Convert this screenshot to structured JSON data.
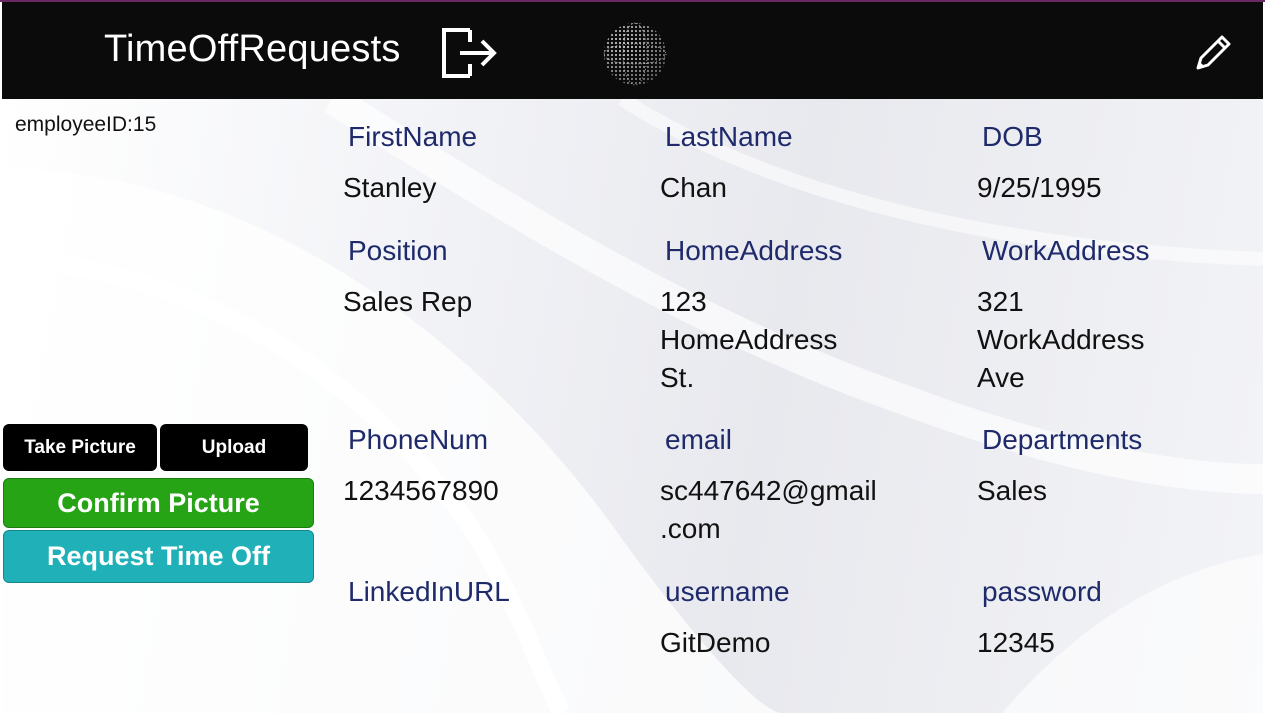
{
  "header": {
    "title": "TimeOffRequests",
    "icons": [
      "logout-icon",
      "globe-icon",
      "edit-icon"
    ]
  },
  "employee": {
    "id_label": "employeeID:15"
  },
  "fields": {
    "first_name": {
      "label": "FirstName",
      "value": "Stanley"
    },
    "last_name": {
      "label": "LastName",
      "value": "Chan"
    },
    "dob": {
      "label": "DOB",
      "value": "9/25/1995"
    },
    "position": {
      "label": "Position",
      "value": "Sales Rep"
    },
    "home_address": {
      "label": "HomeAddress",
      "value": "123\nHomeAddress\nSt."
    },
    "work_address": {
      "label": "WorkAddress",
      "value": "321\nWorkAddress\nAve"
    },
    "phone": {
      "label": "PhoneNum",
      "value": "1234567890"
    },
    "email": {
      "label": "email",
      "value": "sc447642@gmail\n.com"
    },
    "departments": {
      "label": "Departments",
      "value": "Sales"
    },
    "linkedin": {
      "label": "LinkedInURL",
      "value": ""
    },
    "username": {
      "label": "username",
      "value": "GitDemo"
    },
    "password": {
      "label": "password",
      "value": "12345"
    }
  },
  "actions": {
    "take_picture": "Take Picture",
    "upload": "Upload",
    "confirm_picture": "Confirm Picture",
    "request_time_off": "Request Time Off"
  },
  "colors": {
    "header_bg": "#0b0b0b",
    "label_text": "#1f2a6b",
    "confirm_green": "#26a415",
    "request_teal": "#1fb0b8"
  }
}
